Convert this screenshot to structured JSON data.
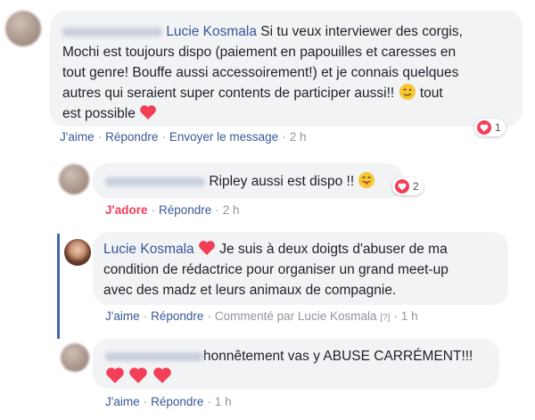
{
  "comments": [
    {
      "author": "Lucie Kosmala",
      "text_lines": [
        "Si tu veux interviewer des corgis,",
        "Mochi est toujours dispo (paiement en papouilles et caresses en",
        "tout genre! Bouffe aussi accessoirement!) et je connais quelques",
        "autres qui seraient super contents de participer aussi!!",
        "tout",
        "est possible"
      ],
      "reaction_count": "1",
      "actions": {
        "like": "J'aime",
        "reply": "Répondre",
        "message": "Envoyer le message",
        "time": "2 h"
      }
    },
    {
      "text": "Ripley aussi est dispo !!",
      "reaction_count": "2",
      "actions": {
        "like": "J'adore",
        "reply": "Répondre",
        "time": "2 h"
      }
    },
    {
      "author": "Lucie Kosmala",
      "text_lines": [
        "Je suis à deux doigts d'abuser de ma",
        "condition de rédactrice pour organiser un grand meet-up",
        "avec des madz et leurs animaux de compagnie."
      ],
      "actions": {
        "like": "J'aime",
        "reply": "Répondre",
        "commented_by": "Commenté par Lucie Kosmala",
        "help": "[?]",
        "time": "1 h"
      }
    },
    {
      "text": "honnêtement vas y ABUSE CARRÉMENT!!!",
      "actions": {
        "like": "J'aime",
        "reply": "Répondre",
        "time": "1 h"
      }
    }
  ],
  "colors": {
    "link": "#385898",
    "heart": "#f33e58",
    "bubble": "#f2f3f5",
    "thread": "#4267b2"
  }
}
